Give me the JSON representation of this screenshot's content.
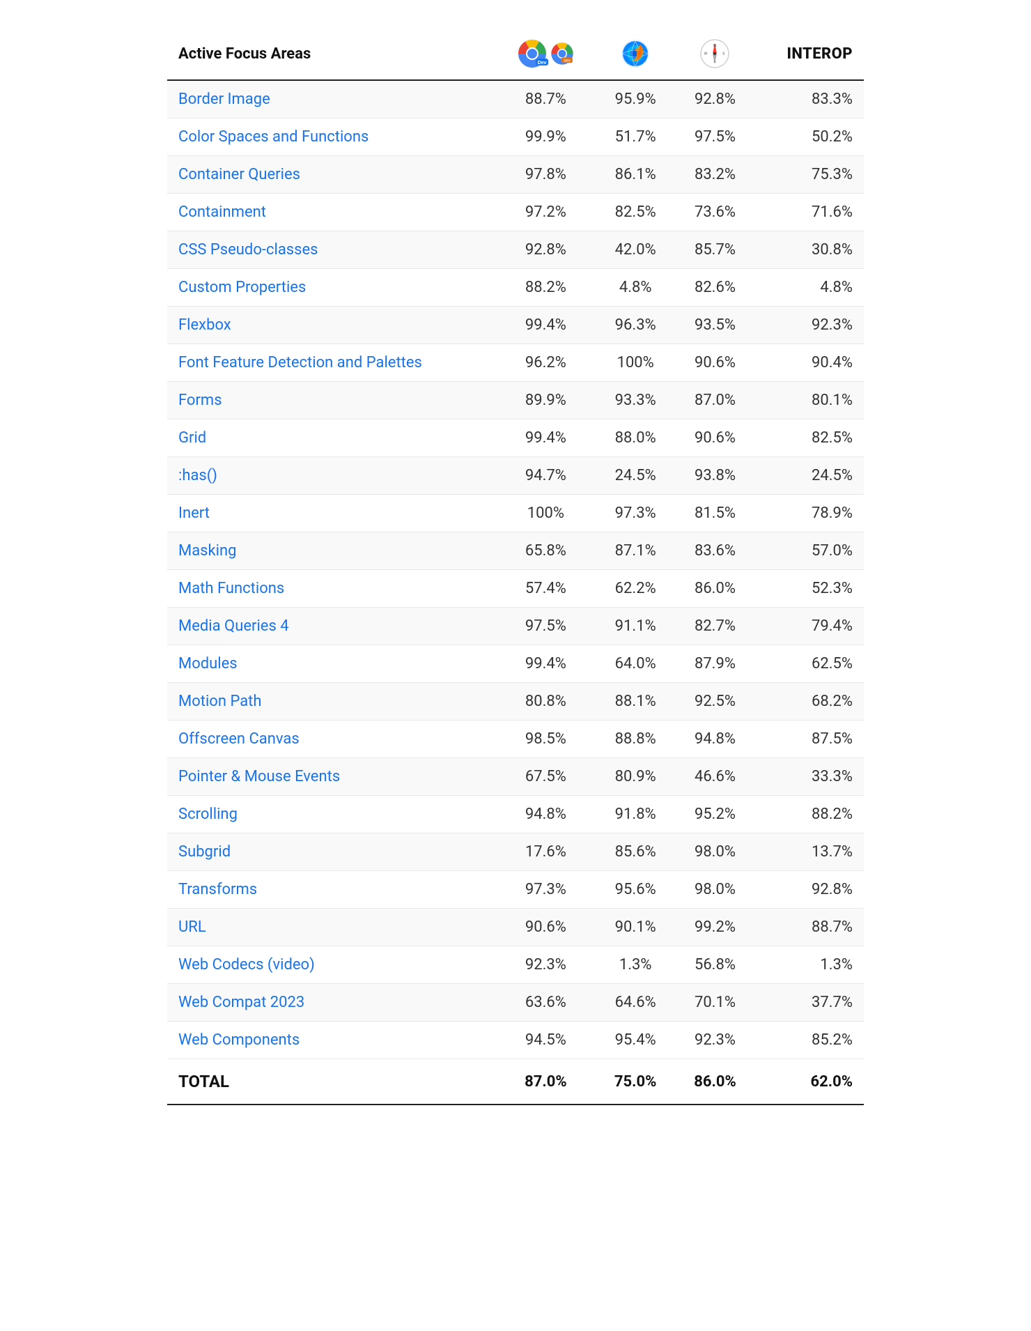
{
  "header": {
    "title": "Active Focus Areas",
    "interop_label": "INTEROP"
  },
  "columns": {
    "chrome_dev": "Chrome Dev",
    "firefox": "Firefox",
    "safari": "Safari",
    "interop": "INTEROP"
  },
  "rows": [
    {
      "name": "Border Image",
      "chrome": "88.7%",
      "firefox": "95.9%",
      "safari": "92.8%",
      "interop": "83.3%"
    },
    {
      "name": "Color Spaces and Functions",
      "chrome": "99.9%",
      "firefox": "51.7%",
      "safari": "97.5%",
      "interop": "50.2%"
    },
    {
      "name": "Container Queries",
      "chrome": "97.8%",
      "firefox": "86.1%",
      "safari": "83.2%",
      "interop": "75.3%"
    },
    {
      "name": "Containment",
      "chrome": "97.2%",
      "firefox": "82.5%",
      "safari": "73.6%",
      "interop": "71.6%"
    },
    {
      "name": "CSS Pseudo-classes",
      "chrome": "92.8%",
      "firefox": "42.0%",
      "safari": "85.7%",
      "interop": "30.8%"
    },
    {
      "name": "Custom Properties",
      "chrome": "88.2%",
      "firefox": "4.8%",
      "safari": "82.6%",
      "interop": "4.8%"
    },
    {
      "name": "Flexbox",
      "chrome": "99.4%",
      "firefox": "96.3%",
      "safari": "93.5%",
      "interop": "92.3%"
    },
    {
      "name": "Font Feature Detection and Palettes",
      "chrome": "96.2%",
      "firefox": "100%",
      "safari": "90.6%",
      "interop": "90.4%"
    },
    {
      "name": "Forms",
      "chrome": "89.9%",
      "firefox": "93.3%",
      "safari": "87.0%",
      "interop": "80.1%"
    },
    {
      "name": "Grid",
      "chrome": "99.4%",
      "firefox": "88.0%",
      "safari": "90.6%",
      "interop": "82.5%"
    },
    {
      "name": ":has()",
      "chrome": "94.7%",
      "firefox": "24.5%",
      "safari": "93.8%",
      "interop": "24.5%"
    },
    {
      "name": "Inert",
      "chrome": "100%",
      "firefox": "97.3%",
      "safari": "81.5%",
      "interop": "78.9%"
    },
    {
      "name": "Masking",
      "chrome": "65.8%",
      "firefox": "87.1%",
      "safari": "83.6%",
      "interop": "57.0%"
    },
    {
      "name": "Math Functions",
      "chrome": "57.4%",
      "firefox": "62.2%",
      "safari": "86.0%",
      "interop": "52.3%"
    },
    {
      "name": "Media Queries 4",
      "chrome": "97.5%",
      "firefox": "91.1%",
      "safari": "82.7%",
      "interop": "79.4%"
    },
    {
      "name": "Modules",
      "chrome": "99.4%",
      "firefox": "64.0%",
      "safari": "87.9%",
      "interop": "62.5%"
    },
    {
      "name": "Motion Path",
      "chrome": "80.8%",
      "firefox": "88.1%",
      "safari": "92.5%",
      "interop": "68.2%"
    },
    {
      "name": "Offscreen Canvas",
      "chrome": "98.5%",
      "firefox": "88.8%",
      "safari": "94.8%",
      "interop": "87.5%"
    },
    {
      "name": "Pointer & Mouse Events",
      "chrome": "67.5%",
      "firefox": "80.9%",
      "safari": "46.6%",
      "interop": "33.3%"
    },
    {
      "name": "Scrolling",
      "chrome": "94.8%",
      "firefox": "91.8%",
      "safari": "95.2%",
      "interop": "88.2%"
    },
    {
      "name": "Subgrid",
      "chrome": "17.6%",
      "firefox": "85.6%",
      "safari": "98.0%",
      "interop": "13.7%"
    },
    {
      "name": "Transforms",
      "chrome": "97.3%",
      "firefox": "95.6%",
      "safari": "98.0%",
      "interop": "92.8%"
    },
    {
      "name": "URL",
      "chrome": "90.6%",
      "firefox": "90.1%",
      "safari": "99.2%",
      "interop": "88.7%"
    },
    {
      "name": "Web Codecs (video)",
      "chrome": "92.3%",
      "firefox": "1.3%",
      "safari": "56.8%",
      "interop": "1.3%"
    },
    {
      "name": "Web Compat 2023",
      "chrome": "63.6%",
      "firefox": "64.6%",
      "safari": "70.1%",
      "interop": "37.7%"
    },
    {
      "name": "Web Components",
      "chrome": "94.5%",
      "firefox": "95.4%",
      "safari": "92.3%",
      "interop": "85.2%"
    }
  ],
  "total": {
    "label": "TOTAL",
    "chrome": "87.0%",
    "firefox": "75.0%",
    "safari": "86.0%",
    "interop": "62.0%"
  }
}
